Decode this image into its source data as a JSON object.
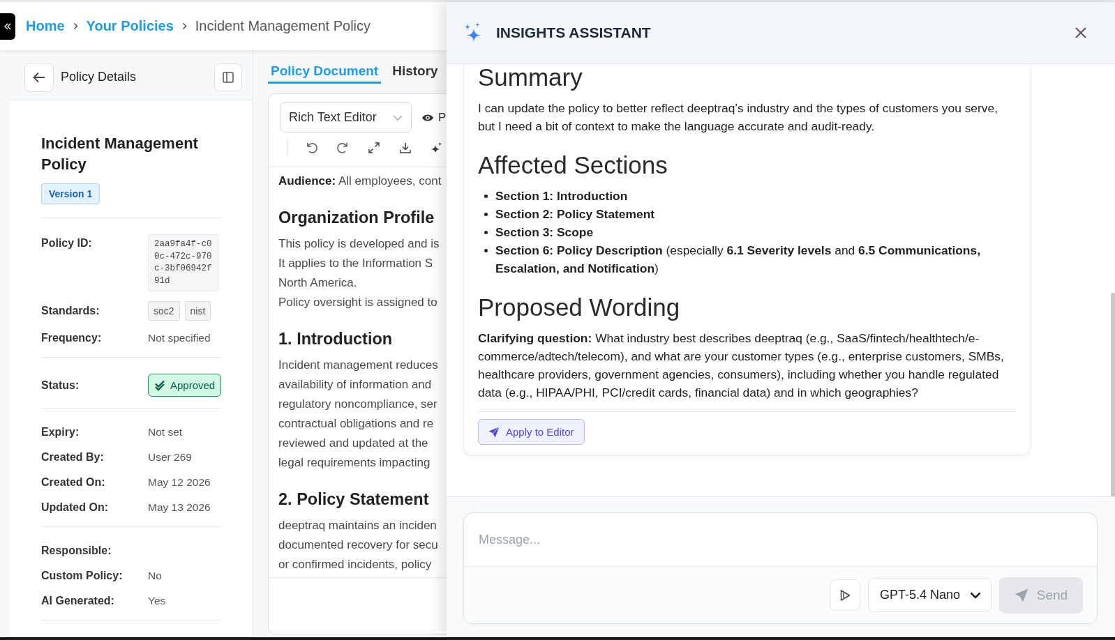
{
  "breadcrumb": [
    {
      "label": "Home",
      "kind": "link"
    },
    {
      "label": "Your Policies",
      "kind": "link"
    },
    {
      "label": "Incident Management Policy",
      "kind": "current"
    }
  ],
  "details_panel": {
    "title": "Policy Details",
    "policy_name": "Incident Management Policy",
    "version": "Version 1",
    "groups": [
      {
        "fields": [
          {
            "label": "Policy ID:",
            "kind": "code",
            "value": "2aa9fa4f-c00c-472c-970c-3bf06942f91d"
          },
          {
            "label": "Standards:",
            "kind": "tags",
            "tags": [
              "soc2",
              "nist"
            ]
          },
          {
            "label": "Frequency:",
            "kind": "text",
            "value": "Not specified"
          }
        ]
      },
      {
        "fields": [
          {
            "label": "Status:",
            "kind": "status",
            "value": "Approved"
          }
        ]
      },
      {
        "fields": [
          {
            "label": "Expiry:",
            "kind": "text",
            "value": "Not set"
          },
          {
            "label": "Created By:",
            "kind": "text",
            "value": "User 269"
          },
          {
            "label": "Created On:",
            "kind": "text",
            "value": "May 12 2026"
          },
          {
            "label": "Updated On:",
            "kind": "text",
            "value": "May 13 2026"
          }
        ]
      },
      {
        "fields": [
          {
            "label": "Responsible:",
            "kind": "text"
          },
          {
            "label": "Custom Policy:",
            "kind": "text",
            "value": "No"
          },
          {
            "label": "AI Generated:",
            "kind": "text",
            "value": "Yes"
          }
        ]
      }
    ]
  },
  "document": {
    "tabs": [
      {
        "label": "Policy Document",
        "selected": true
      },
      {
        "label": "History",
        "selected": false
      }
    ],
    "editor_mode": "Rich Text Editor",
    "preview_label": "P",
    "content": [
      {
        "kind": "paragraph",
        "lines": [
          "**Audience:** All employees, cont"
        ]
      },
      {
        "kind": "heading",
        "text": "Organization Profile"
      },
      {
        "kind": "paragraph",
        "lines": [
          "This policy is developed and is",
          "It applies to the Information S",
          "North America.",
          "Policy oversight is assigned to"
        ]
      },
      {
        "kind": "heading",
        "text": "1. Introduction"
      },
      {
        "kind": "paragraph",
        "lines": [
          "Incident management reduces",
          "availability of information and",
          "regulatory noncompliance, ser",
          "contractual obligations and re",
          "reviewed and updated at the",
          "legal requirements impacting"
        ]
      },
      {
        "kind": "heading",
        "text": "2. Policy Statement"
      },
      {
        "kind": "paragraph",
        "lines": [
          "deeptraq maintains an inciden",
          "documented recovery for secu",
          "or confirmed incidents, policy"
        ]
      }
    ]
  },
  "assistant": {
    "title": "INSIGHTS ASSISTANT",
    "message": {
      "blocks": [
        {
          "kind": "heading",
          "text": "Summary"
        },
        {
          "kind": "paragraph",
          "text": "I can update the policy to better reflect deeptraq’s industry and the types of customers you serve, but I need a bit of context to make the language accurate and audit-ready."
        },
        {
          "kind": "heading",
          "text": "Affected Sections"
        },
        {
          "kind": "list",
          "items": [
            "**Section 1: Introduction**",
            "**Section 2: Policy Statement**",
            "**Section 3: Scope**",
            "**Section 6: Policy Description** (especially **6.1 Severity levels** and **6.5 Communications, Escalation, and Notification**)"
          ]
        },
        {
          "kind": "heading",
          "text": "Proposed Wording"
        },
        {
          "kind": "paragraph",
          "text": "**Clarifying question:** What industry best describes deeptraq (e.g., SaaS/fintech/healthtech/e-commerce/adtech/telecom), and what are your customer types (e.g., enterprise customers, SMBs, healthcare providers, government agencies, consumers), including whether you handle regulated data (e.g., HIPAA/PHI, PCI/credit cards, financial data) and in which geographies?"
        }
      ],
      "action": "Apply to Editor"
    },
    "composer": {
      "placeholder": "Message...",
      "model": "GPT-5.4 Nano",
      "send": {
        "label": "Send",
        "disabled": true
      }
    }
  }
}
